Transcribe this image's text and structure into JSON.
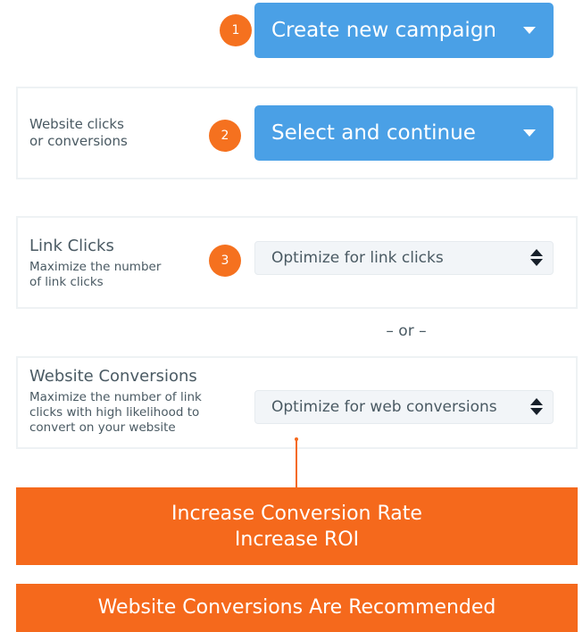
{
  "step1": {
    "badge": "1",
    "button_label": "Create new campaign"
  },
  "step2": {
    "badge": "2",
    "label_line1": "Website clicks",
    "label_line2": "or conversions",
    "button_label": "Select and continue"
  },
  "step3": {
    "badge": "3",
    "title": "Link Clicks",
    "desc_line1": "Maximize the number",
    "desc_line2": "of link clicks",
    "select_value": "Optimize for link clicks"
  },
  "separator": "– or –",
  "conversions_option": {
    "title": "Website Conversions",
    "desc_line1": "Maximize the number of link",
    "desc_line2": "clicks with high likelihood to",
    "desc_line3": "convert on your website",
    "select_value": "Optimize for web conversions"
  },
  "banner_benefits": {
    "line1": "Increase Conversion Rate",
    "line2": "Increase ROI"
  },
  "banner_recommendation": "Website Conversions Are Recommended",
  "colors": {
    "accent_orange": "#f5711f",
    "button_blue": "#4aa0e6",
    "text_gray": "#4a5a63"
  }
}
